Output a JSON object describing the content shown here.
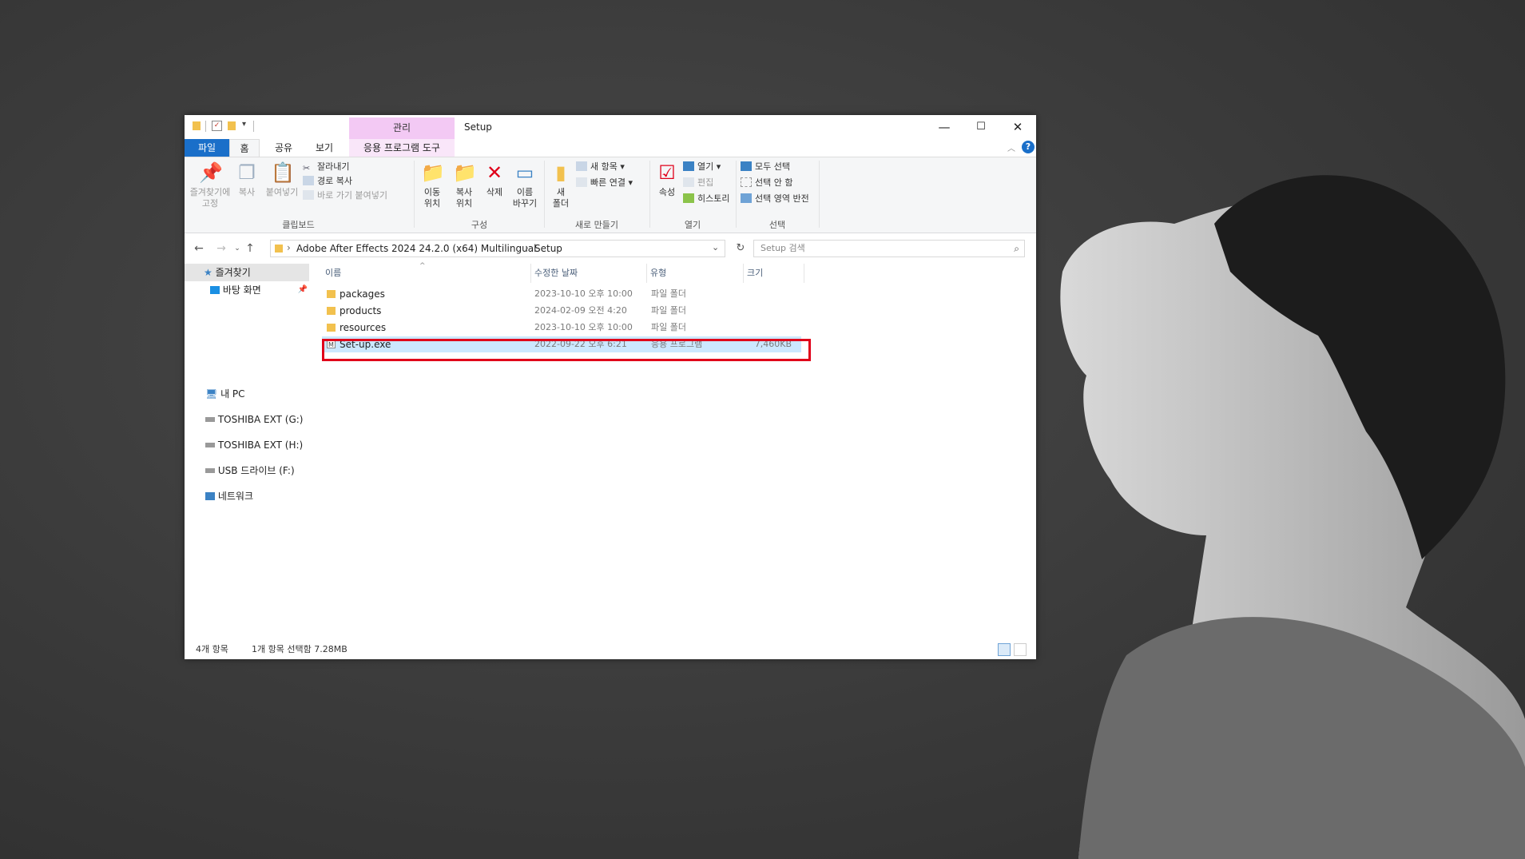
{
  "quick_access_icons": [
    "folder-icon",
    "checkbox-icon",
    "folder-icon",
    "dropdown-arrow-icon"
  ],
  "titlebar": {
    "context_tab": "관리",
    "title": "Setup",
    "minimize": "—",
    "maximize": "☐",
    "close": "✕"
  },
  "ribbon_tabs": {
    "file": "파일",
    "home": "홈",
    "share": "공유",
    "view": "보기",
    "app_tools": "응용 프로그램 도구"
  },
  "ribbon": {
    "clipboard": {
      "pin_label_1": "즐겨찾기에",
      "pin_label_2": "고정",
      "copy": "복사",
      "paste": "붙여넣기",
      "cut": "잘라내기",
      "copy_path": "경로 복사",
      "paste_shortcut": "바로 가기 붙여넣기",
      "group": "클립보드"
    },
    "organize": {
      "move_1": "이동",
      "move_2": "위치",
      "copy_1": "복사",
      "copy_2": "위치",
      "delete": "삭제",
      "rename_1": "이름",
      "rename_2": "바꾸기",
      "group": "구성"
    },
    "new": {
      "folder_1": "새",
      "folder_2": "폴더",
      "new_item": "새 항목",
      "easy_access": "빠른 연결",
      "group": "새로 만들기"
    },
    "open": {
      "properties": "속성",
      "open": "열기",
      "edit": "편집",
      "history": "히스토리",
      "group": "열기"
    },
    "select": {
      "select_all": "모두 선택",
      "select_none": "선택 안 함",
      "invert": "선택 영역 반전",
      "group": "선택"
    }
  },
  "address": {
    "path": [
      "Adobe After Effects 2024 24.2.0 (x64) Multilingual",
      "Setup"
    ],
    "separator": "›",
    "search_placeholder": "Setup 검색"
  },
  "nav_pane": {
    "quick_access": "즐겨찾기",
    "desktop": "바탕 화면",
    "this_pc": "내 PC",
    "drives": [
      "TOSHIBA EXT (G:)",
      "TOSHIBA EXT (H:)",
      "USB 드라이브 (F:)"
    ],
    "network": "네트워크"
  },
  "columns": {
    "name": "이름",
    "date": "수정한 날짜",
    "type": "유형",
    "size": "크기"
  },
  "files": [
    {
      "name": "packages",
      "date": "2023-10-10 오후 10:00",
      "type": "파일 폴더",
      "size": ""
    },
    {
      "name": "products",
      "date": "2024-02-09 오전 4:20",
      "type": "파일 폴더",
      "size": ""
    },
    {
      "name": "resources",
      "date": "2023-10-10 오후 10:00",
      "type": "파일 폴더",
      "size": ""
    },
    {
      "name": "Set-up.exe",
      "date": "2022-09-22 오후 6:21",
      "type": "응용 프로그램",
      "size": "7,460KB"
    }
  ],
  "status": {
    "count": "4개 항목",
    "selection": "1개 항목 선택함 7.28MB"
  },
  "colors": {
    "file_tab": "#1a6fc9",
    "context_tab": "#f3c9f4",
    "selection": "#cce8ff",
    "highlight": "#e0001a",
    "folder": "#f2c14e"
  }
}
